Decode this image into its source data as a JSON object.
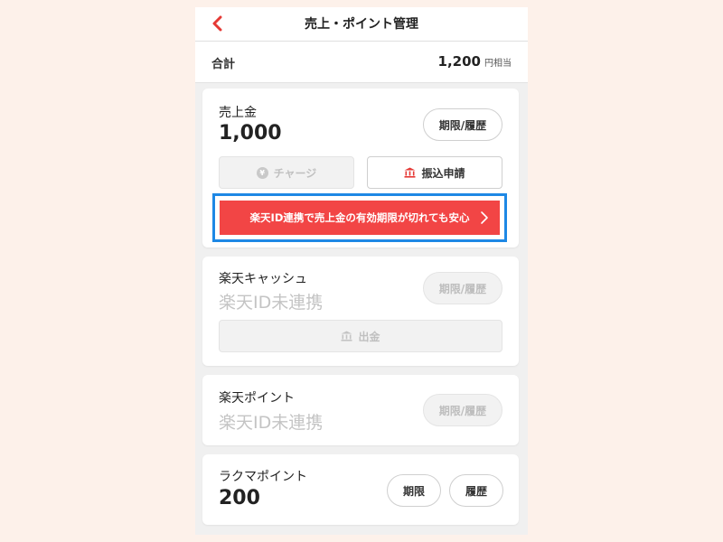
{
  "header": {
    "title": "売上・ポイント管理"
  },
  "total": {
    "label": "合計",
    "amount": "1,200",
    "unit": "円相当"
  },
  "sales": {
    "title": "売上金",
    "value": "1,000",
    "history_label": "期限/履歴",
    "charge_label": "チャージ",
    "charge_icon_glyph": "¥",
    "transfer_label": "振込申請",
    "promo_label": "楽天ID連携で売上金の有効期限が切れても安心"
  },
  "cash": {
    "title": "楽天キャッシュ",
    "value": "楽天ID未連携",
    "history_label": "期限/履歴",
    "withdraw_label": "出金"
  },
  "rakuten_point": {
    "title": "楽天ポイント",
    "value": "楽天ID未連携",
    "history_label": "期限/履歴"
  },
  "rakuma_point": {
    "title": "ラクマポイント",
    "value": "200",
    "expiry_label": "期限",
    "history_label": "履歴"
  },
  "colors": {
    "accent_red": "#f24545",
    "highlight_blue": "#1e88e5",
    "page_bg": "#fdf1ea"
  },
  "icons": {
    "back": "chevron-left-icon",
    "bank": "bank-icon",
    "coin": "yen-coin-icon",
    "promo_arrow": "chevron-right-icon"
  }
}
